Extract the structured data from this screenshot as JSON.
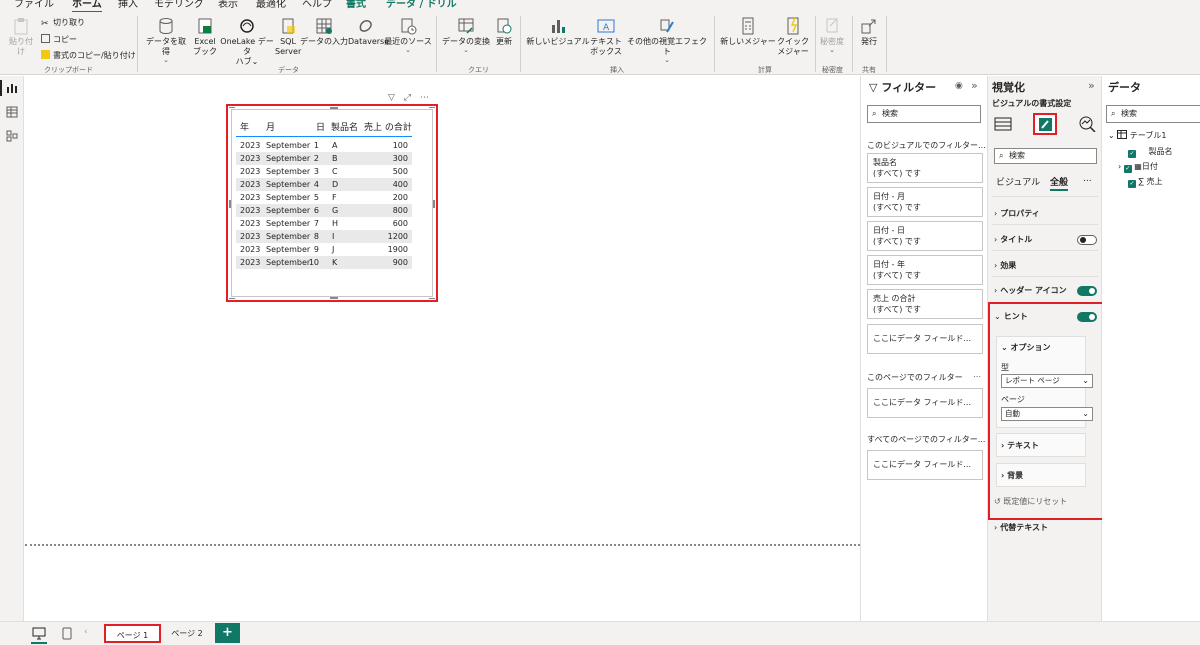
{
  "menu": {
    "tabs": [
      "ファイル",
      "ホーム",
      "挿入",
      "モデリング",
      "表示",
      "最適化",
      "ヘルプ",
      "書式",
      "データ / ドリル"
    ]
  },
  "ribbon": {
    "clipboard": {
      "paste": "貼り付け",
      "cut": "切り取り",
      "copy": "コピー",
      "format_painter": "書式のコピー/貼り付け",
      "group": "クリップボード"
    },
    "data": {
      "get_data": "データを取得",
      "excel_1": "Excel",
      "excel_2": "ブック",
      "onelake_1": "OneLake データ",
      "onelake_2": "ハブ",
      "sql_1": "SQL",
      "sql_2": "Server",
      "enter_data": "データの入力",
      "dataverse": "Dataverse",
      "recent": "最近のソース",
      "group": "データ"
    },
    "query": {
      "transform": "データの変換",
      "refresh": "更新",
      "group": "クエリ"
    },
    "insert": {
      "new_visual": "新しいビジュアル",
      "textbox_1": "テキスト",
      "textbox_2": "ボックス",
      "more_visuals": "その他の視覚エフェクト",
      "group": "挿入"
    },
    "calc": {
      "new_measure": "新しいメジャー",
      "quick_1": "クイック",
      "quick_2": "メジャー",
      "group": "計算"
    },
    "sensitivity": {
      "label": "秘密度",
      "group": "秘密度"
    },
    "share": {
      "publish": "発行",
      "group": "共有"
    }
  },
  "table": {
    "headers": [
      "年",
      "月",
      "日",
      "製品名",
      "売上 の合計"
    ],
    "rows": [
      [
        "2023",
        "September",
        "1",
        "A",
        "100"
      ],
      [
        "2023",
        "September",
        "2",
        "B",
        "300"
      ],
      [
        "2023",
        "September",
        "3",
        "C",
        "500"
      ],
      [
        "2023",
        "September",
        "4",
        "D",
        "400"
      ],
      [
        "2023",
        "September",
        "5",
        "F",
        "200"
      ],
      [
        "2023",
        "September",
        "6",
        "G",
        "800"
      ],
      [
        "2023",
        "September",
        "7",
        "H",
        "600"
      ],
      [
        "2023",
        "September",
        "8",
        "I",
        "1200"
      ],
      [
        "2023",
        "September",
        "9",
        "J",
        "1900"
      ],
      [
        "2023",
        "September",
        "10",
        "K",
        "900"
      ]
    ]
  },
  "filters": {
    "title": "フィルター",
    "search_placeholder": "検索",
    "visual_section": "このビジュアルでのフィルター...",
    "cards": [
      {
        "name": "製品名",
        "state": "(すべて) です"
      },
      {
        "name": "日付 - 月",
        "state": "(すべて) です"
      },
      {
        "name": "日付 - 日",
        "state": "(すべて) です"
      },
      {
        "name": "日付 - 年",
        "state": "(すべて) です"
      },
      {
        "name": "売上 の合計",
        "state": "(すべて) です"
      }
    ],
    "add_field": "ここにデータ フィールド...",
    "page_section": "このページでのフィルター",
    "page_add_field": "ここにデータ フィールド...",
    "all_section": "すべてのページでのフィルター...",
    "all_add_field": "ここにデータ フィールド..."
  },
  "viz": {
    "title": "視覚化",
    "subtitle": "ビジュアルの書式設定",
    "search_placeholder": "検索",
    "tab_visual": "ビジュアル",
    "tab_general": "全般",
    "more": "...",
    "sections": {
      "properties": "プロパティ",
      "title": "タイトル",
      "effects": "効果",
      "header_icons": "ヘッダー アイコン",
      "tooltip": "ヒント",
      "options": "オプション",
      "type_label": "型",
      "type_value": "レポート ページ",
      "page_label": "ページ",
      "page_value": "自動",
      "text": "テキスト",
      "background": "背景",
      "reset": "既定値にリセット",
      "alt_text": "代替テキスト"
    },
    "toggles": {
      "title": "off",
      "header_icons": "on",
      "tooltip": "on"
    },
    "accent": "#117865",
    "highlight": "#e01f26"
  },
  "data_pane": {
    "title": "データ",
    "search_placeholder": "検索",
    "table_name": "テーブル1",
    "fields": [
      "製品名",
      "日付",
      "売上"
    ]
  },
  "pages": {
    "tabs": [
      "ページ 1",
      "ページ 2"
    ],
    "add": "+"
  }
}
